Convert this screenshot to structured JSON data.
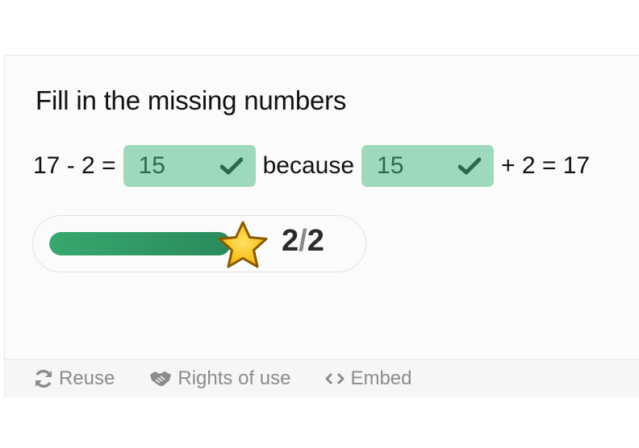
{
  "exercise": {
    "title": "Fill in the missing numbers",
    "equation": {
      "part1": "17 - 2 =",
      "answer1": "15",
      "part2": "because",
      "answer2": "15",
      "part3": "+ 2 = 17"
    },
    "answer_status": "correct",
    "colors": {
      "answer_bg": "#9fd9bd",
      "answer_text": "#2b6b4d",
      "progress_fill": "#2f9a63",
      "star": "#f5c518"
    }
  },
  "progress": {
    "fraction": 1.0,
    "score_done": "2",
    "score_sep": "/",
    "score_total": "2"
  },
  "footer": {
    "items": [
      {
        "label": "Reuse",
        "icon": "refresh-icon"
      },
      {
        "label": "Rights of use",
        "icon": "handshake-icon"
      },
      {
        "label": "Embed",
        "icon": "code-icon"
      }
    ]
  }
}
